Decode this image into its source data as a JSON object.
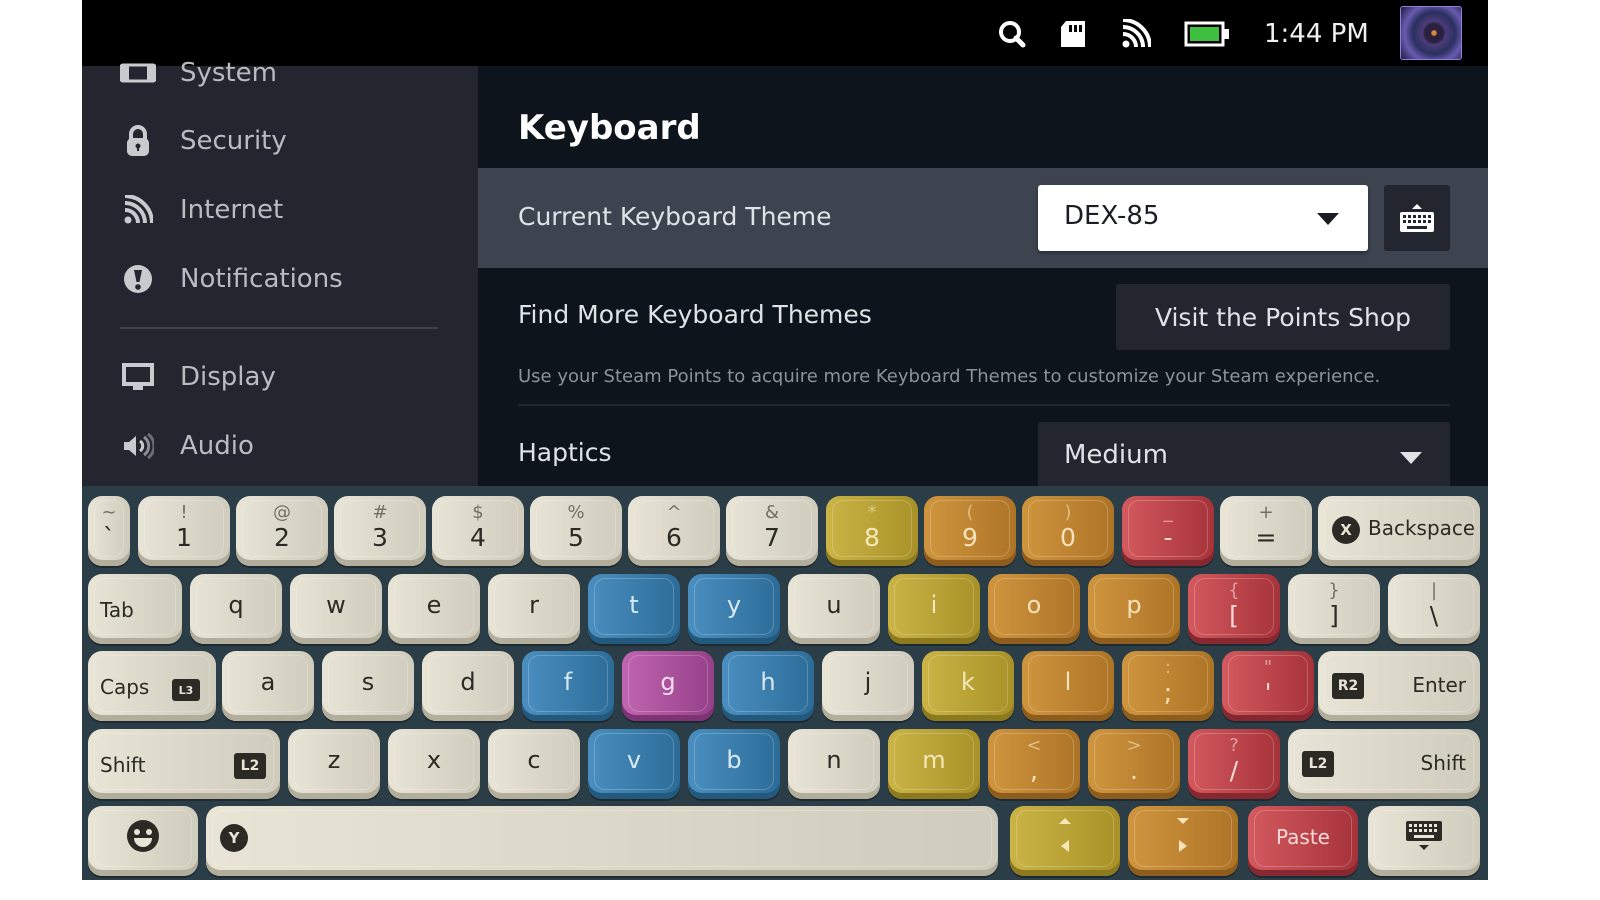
{
  "status_bar": {
    "time": "1:44 PM",
    "icons": [
      "search-icon",
      "sd-card-icon",
      "wifi-icon",
      "battery-icon"
    ],
    "battery_color": "#3fbf3f",
    "avatar": "user-avatar"
  },
  "sidebar": {
    "items": [
      {
        "label": "System",
        "icon": "handheld-icon"
      },
      {
        "label": "Security",
        "icon": "lock-icon"
      },
      {
        "label": "Internet",
        "icon": "wifi-icon"
      },
      {
        "label": "Notifications",
        "icon": "alert-icon"
      },
      {
        "label": "Display",
        "icon": "monitor-icon"
      },
      {
        "label": "Audio",
        "icon": "speaker-icon"
      }
    ]
  },
  "main": {
    "title": "Keyboard",
    "theme_row": {
      "label": "Current Keyboard Theme",
      "value": "DEX-85"
    },
    "find_row": {
      "label": "Find More Keyboard Themes",
      "button": "Visit the Points Shop",
      "description": "Use your Steam Points to acquire more Keyboard Themes to customize your Steam experience."
    },
    "haptics_row": {
      "label": "Haptics",
      "value": "Medium"
    }
  },
  "keyboard": {
    "theme_colors": {
      "cream": "#ddd9cb",
      "blue": "#3a7fb0",
      "purple": "#b055a2",
      "yellow": "#bba236",
      "orange": "#c08432",
      "red": "#c2464c",
      "background": "#2b3d47"
    },
    "rows": [
      [
        {
          "main": "`",
          "sub": "~",
          "color": "cream"
        },
        {
          "main": "1",
          "sub": "!",
          "color": "cream"
        },
        {
          "main": "2",
          "sub": "@",
          "color": "cream"
        },
        {
          "main": "3",
          "sub": "#",
          "color": "cream"
        },
        {
          "main": "4",
          "sub": "$",
          "color": "cream"
        },
        {
          "main": "5",
          "sub": "%",
          "color": "cream"
        },
        {
          "main": "6",
          "sub": "^",
          "color": "cream"
        },
        {
          "main": "7",
          "sub": "&",
          "color": "cream"
        },
        {
          "main": "8",
          "sub": "*",
          "color": "yellow"
        },
        {
          "main": "9",
          "sub": "(",
          "color": "orange"
        },
        {
          "main": "0",
          "sub": ")",
          "color": "orange"
        },
        {
          "main": "-",
          "sub": "_",
          "color": "red"
        },
        {
          "main": "=",
          "sub": "+",
          "color": "cream"
        },
        {
          "label": "Backspace",
          "badge": "X",
          "color": "cream"
        }
      ],
      [
        {
          "label": "Tab",
          "color": "cream"
        },
        {
          "main": "q",
          "color": "cream"
        },
        {
          "main": "w",
          "color": "cream"
        },
        {
          "main": "e",
          "color": "cream"
        },
        {
          "main": "r",
          "color": "cream"
        },
        {
          "main": "t",
          "color": "blue"
        },
        {
          "main": "y",
          "color": "blue"
        },
        {
          "main": "u",
          "color": "cream"
        },
        {
          "main": "i",
          "color": "yellow"
        },
        {
          "main": "o",
          "color": "orange"
        },
        {
          "main": "p",
          "color": "orange"
        },
        {
          "main": "[",
          "sub": "{",
          "color": "red"
        },
        {
          "main": "]",
          "sub": "}",
          "color": "cream"
        },
        {
          "main": "\\",
          "sub": "|",
          "color": "cream"
        }
      ],
      [
        {
          "label": "Caps",
          "badge": "L3",
          "color": "cream"
        },
        {
          "main": "a",
          "color": "cream"
        },
        {
          "main": "s",
          "color": "cream"
        },
        {
          "main": "d",
          "color": "cream"
        },
        {
          "main": "f",
          "color": "blue"
        },
        {
          "main": "g",
          "color": "purple"
        },
        {
          "main": "h",
          "color": "blue"
        },
        {
          "main": "j",
          "color": "cream"
        },
        {
          "main": "k",
          "color": "yellow"
        },
        {
          "main": "l",
          "color": "orange"
        },
        {
          "main": ";",
          "sub": ":",
          "color": "orange"
        },
        {
          "main": "'",
          "sub": "\"",
          "color": "red"
        },
        {
          "label": "Enter",
          "badge": "R2",
          "color": "cream"
        }
      ],
      [
        {
          "label": "Shift",
          "badge": "L2",
          "color": "cream"
        },
        {
          "main": "z",
          "color": "cream"
        },
        {
          "main": "x",
          "color": "cream"
        },
        {
          "main": "c",
          "color": "cream"
        },
        {
          "main": "v",
          "color": "blue"
        },
        {
          "main": "b",
          "color": "blue"
        },
        {
          "main": "n",
          "color": "cream"
        },
        {
          "main": "m",
          "color": "yellow"
        },
        {
          "main": ",",
          "sub": "<",
          "color": "orange"
        },
        {
          "main": ".",
          "sub": ">",
          "color": "orange"
        },
        {
          "main": "/",
          "sub": "?",
          "color": "red"
        },
        {
          "label": "Shift",
          "badge": "L2",
          "color": "cream"
        }
      ],
      [
        {
          "label": "emoji",
          "icon": "emoji-icon",
          "color": "cream"
        },
        {
          "label": "space",
          "badge": "Y",
          "color": "cream"
        },
        {
          "label": "up-left",
          "icon": "arrow-up-left-icon",
          "color": "yellow"
        },
        {
          "label": "down-right",
          "icon": "arrow-down-right-icon",
          "color": "orange"
        },
        {
          "label": "Paste",
          "color": "red"
        },
        {
          "label": "hide-keyboard",
          "icon": "keyboard-hide-icon",
          "color": "cream"
        }
      ]
    ]
  }
}
